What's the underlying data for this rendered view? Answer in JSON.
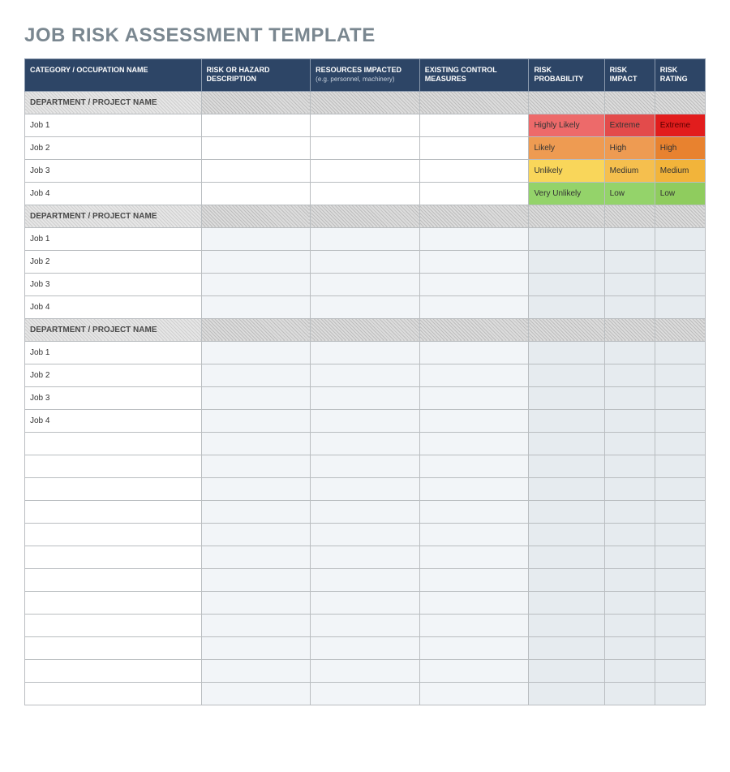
{
  "title": "JOB RISK ASSESSMENT TEMPLATE",
  "headers": {
    "category": "CATEGORY / OCCUPATION NAME",
    "risk_hazard": "RISK OR HAZARD DESCRIPTION",
    "resources": "RESOURCES IMPACTED",
    "resources_sub": "(e.g. personnel, machinery)",
    "existing": "EXISTING CONTROL MEASURES",
    "probability": "RISK PROBABILITY",
    "impact": "RISK IMPACT",
    "rating": "RISK RATING"
  },
  "dept_label": "DEPARTMENT / PROJECT NAME",
  "jobs": {
    "j1": "Job 1",
    "j2": "Job 2",
    "j3": "Job 3",
    "j4": "Job 4"
  },
  "risk": {
    "prob_hl": "Highly Likely",
    "prob_li": "Likely",
    "prob_ul": "Unlikely",
    "prob_vul": "Very Unlikely",
    "imp_ext": "Extreme",
    "imp_high": "High",
    "imp_med": "Medium",
    "imp_low": "Low",
    "rat_ext": "Extreme",
    "rat_high": "High",
    "rat_med": "Medium",
    "rat_low": "Low"
  }
}
